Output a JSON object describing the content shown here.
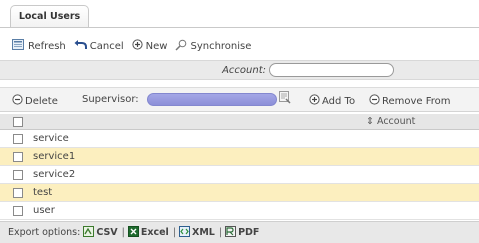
{
  "tab": {
    "label": "Local Users"
  },
  "toolbar": {
    "refresh": "Refresh",
    "cancel": "Cancel",
    "new": "New",
    "synchronise": "Synchronise"
  },
  "account_filter": {
    "label": "Account:",
    "value": ""
  },
  "actions": {
    "delete": "Delete",
    "supervisor_label": "Supervisor:",
    "supervisor_value": "",
    "add_to": "Add To",
    "remove_from": "Remove From"
  },
  "grid": {
    "column_header": "Account",
    "rows": [
      {
        "name": "service",
        "highlighted": false
      },
      {
        "name": "service1",
        "highlighted": true
      },
      {
        "name": "service2",
        "highlighted": false
      },
      {
        "name": "test",
        "highlighted": true
      },
      {
        "name": "user",
        "highlighted": false
      }
    ]
  },
  "export": {
    "label": "Export options:",
    "formats": [
      "CSV",
      "Excel",
      "XML",
      "PDF"
    ],
    "separator": "|"
  },
  "colors": {
    "row_highlight": "#fcefbf",
    "supervisor_field": "#9a9de2",
    "header_bg": "#e6e6e6"
  }
}
